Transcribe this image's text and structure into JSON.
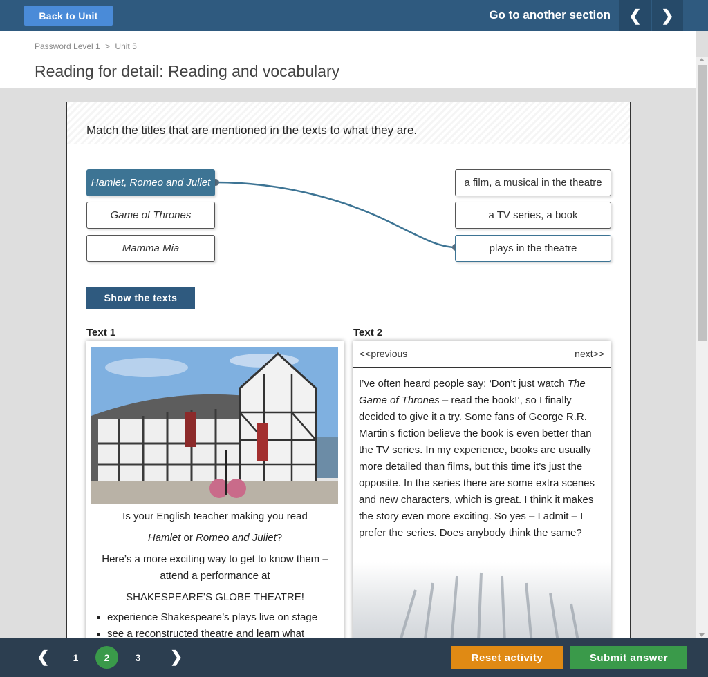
{
  "topbar": {
    "back_label": "Back to Unit",
    "goto_label": "Go to another section",
    "prev_arrow": "❮",
    "next_arrow": "❯"
  },
  "breadcrumb": {
    "items": [
      "Password Level 1",
      "Unit 5"
    ],
    "separator": ">"
  },
  "page_title": "Reading for detail: Reading and vocabulary",
  "activity": {
    "instruction": "Match the titles that are mentioned in the texts to what they are.",
    "left_items": [
      "Hamlet, Romeo and Juliet",
      "Game of Thrones",
      "Mamma Mia"
    ],
    "right_items": [
      "a film, a musical in the theatre",
      "a TV series, a book",
      "plays in the theatre"
    ],
    "selected_left": "Hamlet, Romeo and Juliet",
    "linked_right": "plays in the theatre",
    "link_color": "#3d7494",
    "show_texts_label": "Show the texts"
  },
  "text1": {
    "heading": "Text 1",
    "line1": "Is your English teacher making you read",
    "line2_a": "Hamlet",
    "line2_b": " or ",
    "line2_c": "Romeo and Juliet",
    "line2_d": "?",
    "line3": "Here’s a more exciting way to get to know them – attend a performance at",
    "line4": "SHAKESPEARE’S GLOBE THEATRE!",
    "bullets": [
      "experience Shakespeare’s plays live on stage",
      "see a reconstructed theatre and learn what"
    ]
  },
  "text2": {
    "heading": "Text 2",
    "prev_label": "<<previous",
    "next_label": "next>>",
    "body_a": "I’ve often heard people say: ‘Don’t just watch ",
    "body_b": "The Game of Thrones",
    "body_c": " – read the book!’, so I finally decided to give it a try. Some fans of George R.R. Martin’s fiction believe the book is even better than the TV series. In my experience, books are usually more detailed than films, but this time it’s just the opposite. In the series there are some extra scenes and new characters, which is great. I think it makes the story even more exciting. So yes – I admit – I prefer the series. Does anybody think the same?"
  },
  "bottombar": {
    "prev_arrow": "❮",
    "next_arrow": "❯",
    "pages": [
      "1",
      "2",
      "3"
    ],
    "current_page": "2",
    "reset_label": "Reset activity",
    "submit_label": "Submit answer"
  },
  "colors": {
    "topbar": "#2f5a7f",
    "back_button": "#4a8bd8",
    "reset": "#e08a14",
    "submit": "#3a9a4a"
  }
}
